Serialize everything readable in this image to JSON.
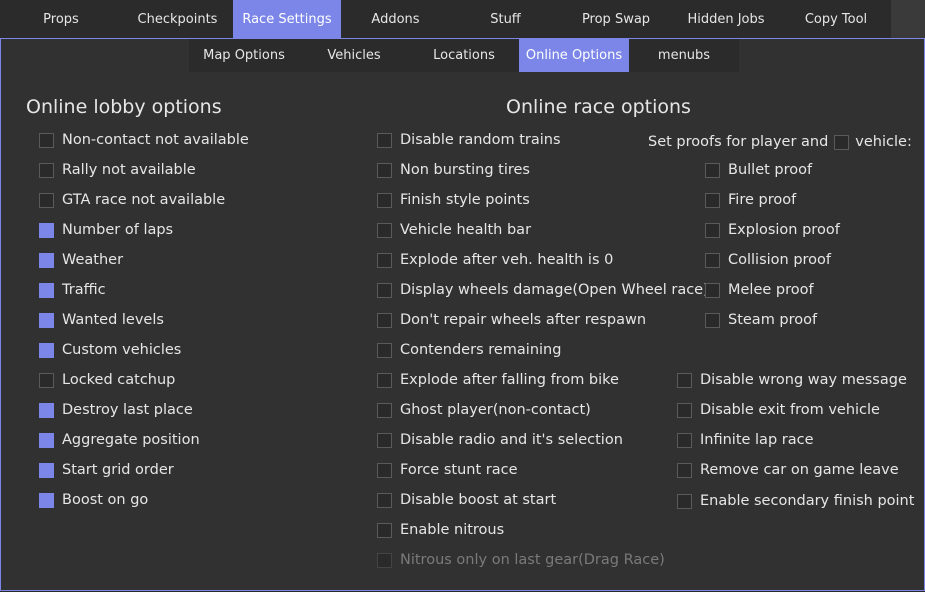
{
  "top_tabs": [
    {
      "label": "Props"
    },
    {
      "label": "Checkpoints"
    },
    {
      "label": "Race Settings",
      "active": true
    },
    {
      "label": "Addons"
    },
    {
      "label": "Stuff"
    },
    {
      "label": "Prop Swap"
    },
    {
      "label": "Hidden Jobs"
    },
    {
      "label": "Copy Tool"
    }
  ],
  "sub_tabs": [
    {
      "label": "Map Options"
    },
    {
      "label": "Vehicles"
    },
    {
      "label": "Locations"
    },
    {
      "label": "Online Options",
      "active": true
    },
    {
      "label": "menubs"
    }
  ],
  "lobby": {
    "title": "Online lobby options",
    "options": [
      {
        "label": "Non-contact not available",
        "checked": false
      },
      {
        "label": "Rally not available",
        "checked": false
      },
      {
        "label": "GTA race not available",
        "checked": false
      },
      {
        "label": "Number of laps",
        "checked": true
      },
      {
        "label": "Weather",
        "checked": true
      },
      {
        "label": "Traffic",
        "checked": true
      },
      {
        "label": "Wanted levels",
        "checked": true
      },
      {
        "label": "Custom vehicles",
        "checked": true
      },
      {
        "label": "Locked catchup",
        "checked": false
      },
      {
        "label": "Destroy last place",
        "checked": true
      },
      {
        "label": "Aggregate position",
        "checked": true
      },
      {
        "label": "Start grid order",
        "checked": true
      },
      {
        "label": "Boost on go",
        "checked": true
      }
    ]
  },
  "race": {
    "title": "Online race options",
    "options": [
      {
        "label": "Disable random trains",
        "checked": false
      },
      {
        "label": "Non bursting tires",
        "checked": false
      },
      {
        "label": "Finish style points",
        "checked": false
      },
      {
        "label": "Vehicle health bar",
        "checked": false
      },
      {
        "label": "Explode after veh. health is 0",
        "checked": false
      },
      {
        "label": "Display wheels damage(Open Wheel race)",
        "checked": false
      },
      {
        "label": "Don't repair wheels after respawn",
        "checked": false
      },
      {
        "label": "Contenders remaining",
        "checked": false
      },
      {
        "label": "Explode after falling from bike",
        "checked": false
      },
      {
        "label": "Ghost player(non-contact)",
        "checked": false
      },
      {
        "label": "Disable radio and it's selection",
        "checked": false
      },
      {
        "label": "Force stunt race",
        "checked": false
      },
      {
        "label": "Disable boost at start",
        "checked": false
      },
      {
        "label": "Enable nitrous",
        "checked": false
      },
      {
        "label": "Nitrous only on last gear(Drag Race)",
        "checked": false,
        "disabled": true
      }
    ]
  },
  "proofs": {
    "header_before": "Set proofs for player and",
    "header_after": "vehicle:",
    "vehicle_checked": false,
    "options": [
      {
        "label": "Bullet proof",
        "checked": false
      },
      {
        "label": "Fire proof",
        "checked": false
      },
      {
        "label": "Explosion proof",
        "checked": false
      },
      {
        "label": "Collision proof",
        "checked": false
      },
      {
        "label": "Melee proof",
        "checked": false
      },
      {
        "label": "Steam proof",
        "checked": false
      }
    ]
  },
  "extra": {
    "options": [
      {
        "label": "Disable wrong way message",
        "checked": false
      },
      {
        "label": "Disable exit from vehicle",
        "checked": false
      },
      {
        "label": "Infinite lap race",
        "checked": false
      },
      {
        "label": "Remove car on game leave",
        "checked": false
      },
      {
        "label": "Enable secondary finish point",
        "checked": false
      }
    ]
  }
}
